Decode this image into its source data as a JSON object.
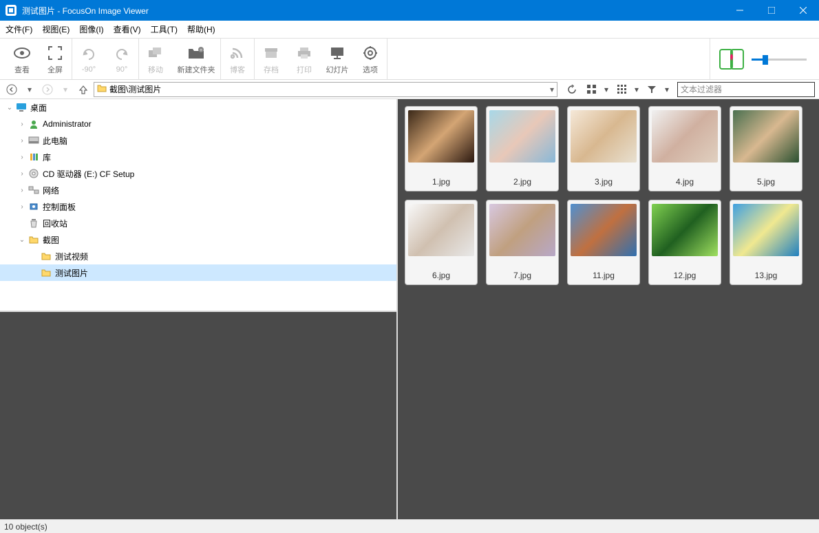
{
  "title": "测试图片 - FocusOn Image Viewer",
  "menu": [
    "文件(F)",
    "视图(E)",
    "图像(I)",
    "查看(V)",
    "工具(T)",
    "帮助(H)"
  ],
  "tools": {
    "view": "查看",
    "fullscreen": "全屏",
    "rotleft": "-90°",
    "rotright": "90°",
    "move": "移动",
    "newfolder": "新建文件夹",
    "blog": "博客",
    "archive": "存档",
    "print": "打印",
    "slideshow": "幻灯片",
    "options": "选项"
  },
  "path": "截图\\测试图片",
  "filter_placeholder": "文本过滤器",
  "tree": [
    {
      "indent": 0,
      "arrow": "v",
      "icon": "desktop",
      "label": "桌面"
    },
    {
      "indent": 1,
      "arrow": ">",
      "icon": "user",
      "label": "Administrator"
    },
    {
      "indent": 1,
      "arrow": ">",
      "icon": "pc",
      "label": "此电脑"
    },
    {
      "indent": 1,
      "arrow": ">",
      "icon": "lib",
      "label": "库"
    },
    {
      "indent": 1,
      "arrow": ">",
      "icon": "cd",
      "label": "CD 驱动器 (E:) CF Setup"
    },
    {
      "indent": 1,
      "arrow": ">",
      "icon": "net",
      "label": "网络"
    },
    {
      "indent": 1,
      "arrow": ">",
      "icon": "panel",
      "label": "控制面板"
    },
    {
      "indent": 1,
      "arrow": "",
      "icon": "recycle",
      "label": "回收站"
    },
    {
      "indent": 1,
      "arrow": "v",
      "icon": "folder",
      "label": "截图"
    },
    {
      "indent": 2,
      "arrow": "",
      "icon": "folder",
      "label": "测试视频"
    },
    {
      "indent": 2,
      "arrow": "",
      "icon": "folder",
      "label": "测试图片",
      "selected": true
    }
  ],
  "thumbs": [
    {
      "name": "1.jpg",
      "bg": "linear-gradient(135deg,#3a2818,#d4a574,#2a1810)"
    },
    {
      "name": "2.jpg",
      "bg": "linear-gradient(135deg,#a8d8e8,#e8c8b8,#88b8d8)"
    },
    {
      "name": "3.jpg",
      "bg": "linear-gradient(135deg,#f5e8d8,#d8b890,#e8e0d0)"
    },
    {
      "name": "4.jpg",
      "bg": "linear-gradient(135deg,#f0f0f0,#d0b0a0,#e0d0c0)"
    },
    {
      "name": "5.jpg",
      "bg": "linear-gradient(135deg,#4a7050,#d8b890,#2a5030)"
    },
    {
      "name": "6.jpg",
      "bg": "linear-gradient(135deg,#f8f8f8,#d0c0b0,#e8e8e8)"
    },
    {
      "name": "7.jpg",
      "bg": "linear-gradient(135deg,#d8c8e0,#c0a080,#b8a8c8)"
    },
    {
      "name": "11.jpg",
      "bg": "linear-gradient(135deg,#5090d0,#c07040,#3070b0)"
    },
    {
      "name": "12.jpg",
      "bg": "linear-gradient(135deg,#80d050,#206020,#a0e060)"
    },
    {
      "name": "13.jpg",
      "bg": "linear-gradient(135deg,#40a0e0,#f0e890,#2080c0)"
    }
  ],
  "status": "10 object(s)"
}
